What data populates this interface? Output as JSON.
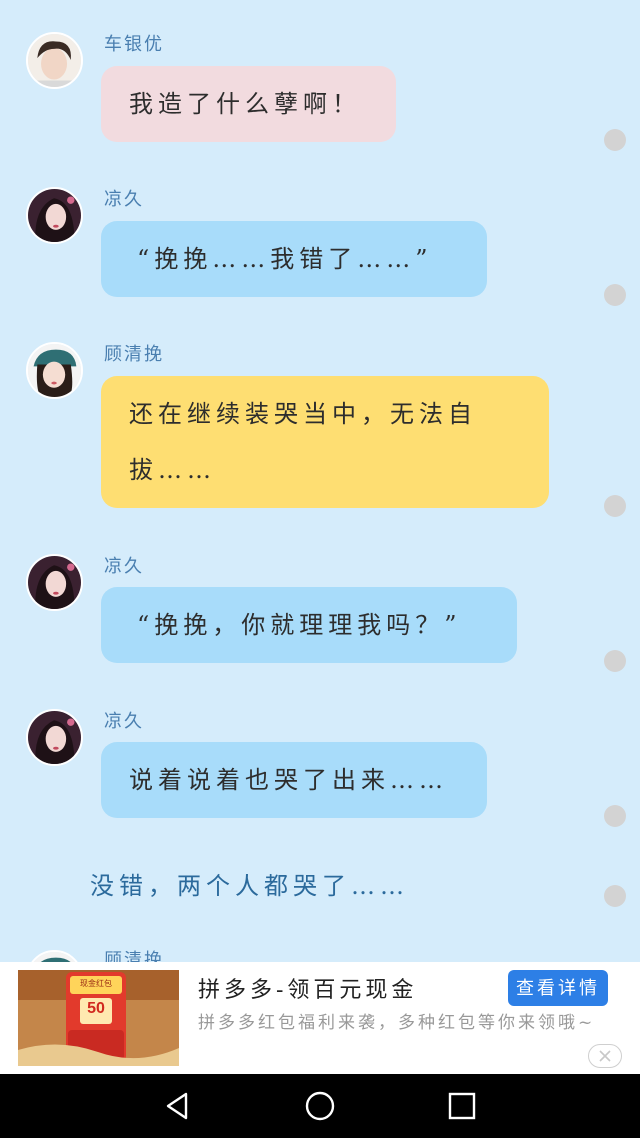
{
  "messages": [
    {
      "name": "车银优",
      "text": "我造了什么孽啊！",
      "avatar": "male-avatar"
    },
    {
      "name": "凉久",
      "text": "“挽挽……我错了……”",
      "avatar": "female-avatar-dark"
    },
    {
      "name": "顾清挽",
      "text_line1": "还在继续装哭当中，无法自",
      "text_line2": "拔……",
      "avatar": "female-avatar-teal-hat"
    },
    {
      "name": "凉久",
      "text": "“挽挽，你就理理我吗？”",
      "avatar": "female-avatar-dark"
    },
    {
      "name": "凉久",
      "text": "说着说着也哭了出来……",
      "avatar": "female-avatar-dark"
    },
    {
      "name": "顾清挽",
      "avatar": "female-avatar-teal-hat"
    }
  ],
  "narration": "没错，两个人都哭了……",
  "ad": {
    "title": "拼多多-领百元现金",
    "description": "拼多多红包福利来袭，多种红包等你来领哦~",
    "button": "查看详情",
    "badge_value": "50",
    "badge_label": "现金红包"
  },
  "colors": {
    "background": "#d5ecfb",
    "bubble_pink": "#f2dbdf",
    "bubble_blue": "#a8dcfa",
    "bubble_yellow": "#fede72",
    "name_color": "#4a7fb0",
    "ad_button": "#2d7fe6"
  },
  "navbar": {
    "back": "back-triangle-icon",
    "home": "home-circle-icon",
    "recents": "recents-square-icon"
  }
}
